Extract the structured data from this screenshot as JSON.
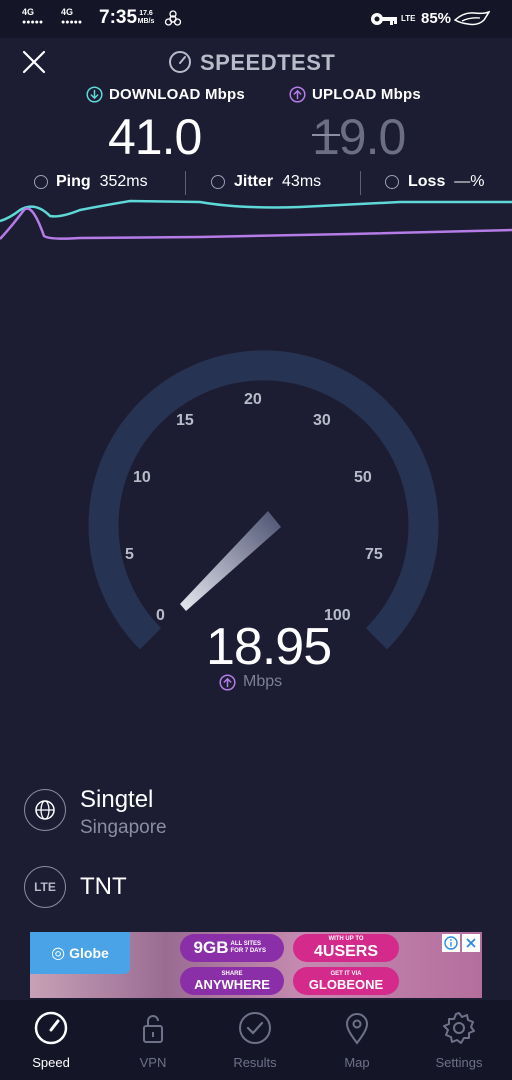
{
  "status_bar": {
    "net1": "4G",
    "net2": "4G",
    "time": "7:35",
    "rate_value": "17.6",
    "rate_unit": "MB/s",
    "lte": "LTE",
    "battery": "85%"
  },
  "header": {
    "title": "SPEEDTEST",
    "download_label": "DOWNLOAD Mbps",
    "upload_label": "UPLOAD Mbps",
    "download_value": "41.0",
    "upload_value": "19.0"
  },
  "stats": {
    "ping_label": "Ping",
    "ping_value": "352ms",
    "jitter_label": "Jitter",
    "jitter_value": "43ms",
    "loss_label": "Loss",
    "loss_value": "—%"
  },
  "gauge": {
    "ticks": [
      "0",
      "5",
      "10",
      "15",
      "20",
      "30",
      "50",
      "75",
      "100"
    ],
    "speed_value": "18.95",
    "unit": "Mbps"
  },
  "isp": {
    "name": "Singtel",
    "location": "Singapore",
    "network_icon_text": "LTE",
    "network": "TNT"
  },
  "ad": {
    "brand": "Globe",
    "pill1_big": "9GB",
    "pill1_small": "ALL SITES FOR 7 DAYS",
    "pill2_small": "WITH UP TO",
    "pill2_big": "4USERS",
    "pill3_small": "SHARE",
    "pill3_big": "ANYWHERE",
    "pill4_small": "GET IT VIA",
    "pill4_big": "GLOBEONE"
  },
  "nav": {
    "items": [
      {
        "label": "Speed",
        "icon": "speedometer-icon"
      },
      {
        "label": "VPN",
        "icon": "lock-icon"
      },
      {
        "label": "Results",
        "icon": "check-circle-icon"
      },
      {
        "label": "Map",
        "icon": "map-pin-icon"
      },
      {
        "label": "Settings",
        "icon": "gear-icon"
      }
    ]
  },
  "colors": {
    "background": "#1c1d33",
    "download_accent": "#5fd8d8",
    "upload_accent": "#b57ce8",
    "gauge_track": "#2b3550"
  }
}
